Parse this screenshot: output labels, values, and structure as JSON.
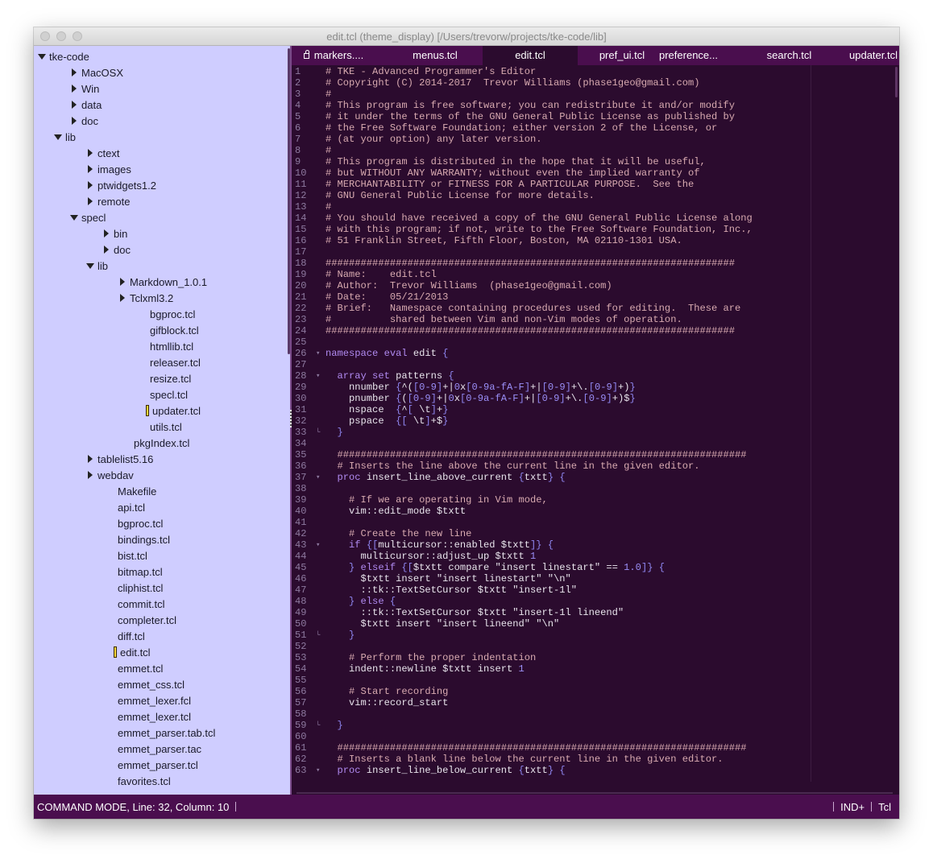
{
  "window": {
    "title": "edit.tcl (theme_display) [/Users/trevorw/projects/tke-code/lib]"
  },
  "colors": {
    "comment": "#d8aab0",
    "keyword": "#b08af0",
    "bracket": "#8f86f0",
    "number": "#9b8ff8",
    "text": "#e8e4ec",
    "sidebar_bg": "#cfcdff",
    "tab_bg": "#4a0e4e",
    "editor_bg": "#2b0b2e"
  },
  "sidebar": {
    "items": [
      {
        "label": "tke-code",
        "type": "folder-open"
      },
      {
        "label": "MacOSX",
        "type": "folder"
      },
      {
        "label": "Win",
        "type": "folder"
      },
      {
        "label": "data",
        "type": "folder"
      },
      {
        "label": "doc",
        "type": "folder"
      },
      {
        "label": "lib",
        "type": "folder-open"
      },
      {
        "label": "ctext",
        "type": "folder"
      },
      {
        "label": "images",
        "type": "folder"
      },
      {
        "label": "ptwidgets1.2",
        "type": "folder"
      },
      {
        "label": "remote",
        "type": "folder"
      },
      {
        "label": "specl",
        "type": "folder-open"
      },
      {
        "label": "bin",
        "type": "folder"
      },
      {
        "label": "doc",
        "type": "folder"
      },
      {
        "label": "lib",
        "type": "folder-open"
      },
      {
        "label": "Markdown_1.0.1",
        "type": "folder"
      },
      {
        "label": "Tclxml3.2",
        "type": "folder"
      },
      {
        "label": "bgproc.tcl",
        "type": "file"
      },
      {
        "label": "gifblock.tcl",
        "type": "file"
      },
      {
        "label": "htmllib.tcl",
        "type": "file"
      },
      {
        "label": "releaser.tcl",
        "type": "file"
      },
      {
        "label": "resize.tcl",
        "type": "file"
      },
      {
        "label": "specl.tcl",
        "type": "file"
      },
      {
        "label": "updater.tcl",
        "type": "file-open"
      },
      {
        "label": "utils.tcl",
        "type": "file"
      },
      {
        "label": "pkgIndex.tcl",
        "type": "file"
      },
      {
        "label": "tablelist5.16",
        "type": "folder"
      },
      {
        "label": "webdav",
        "type": "folder"
      },
      {
        "label": "Makefile",
        "type": "file"
      },
      {
        "label": "api.tcl",
        "type": "file"
      },
      {
        "label": "bgproc.tcl",
        "type": "file"
      },
      {
        "label": "bindings.tcl",
        "type": "file"
      },
      {
        "label": "bist.tcl",
        "type": "file"
      },
      {
        "label": "bitmap.tcl",
        "type": "file"
      },
      {
        "label": "cliphist.tcl",
        "type": "file"
      },
      {
        "label": "commit.tcl",
        "type": "file"
      },
      {
        "label": "completer.tcl",
        "type": "file"
      },
      {
        "label": "diff.tcl",
        "type": "file"
      },
      {
        "label": "edit.tcl",
        "type": "file-open"
      },
      {
        "label": "emmet.tcl",
        "type": "file"
      },
      {
        "label": "emmet_css.tcl",
        "type": "file"
      },
      {
        "label": "emmet_lexer.fcl",
        "type": "file"
      },
      {
        "label": "emmet_lexer.tcl",
        "type": "file"
      },
      {
        "label": "emmet_parser.tab.tcl",
        "type": "file"
      },
      {
        "label": "emmet_parser.tac",
        "type": "file"
      },
      {
        "label": "emmet_parser.tcl",
        "type": "file"
      },
      {
        "label": "favorites.tcl",
        "type": "file"
      }
    ]
  },
  "tabs": [
    {
      "label": "markers....",
      "locked": true
    },
    {
      "label": "menus.tcl"
    },
    {
      "label": "edit.tcl",
      "active": true
    },
    {
      "label": "pref_ui.tcl"
    },
    {
      "label": "preference..."
    },
    {
      "label": "search.tcl"
    },
    {
      "label": "updater.tcl"
    }
  ],
  "code": [
    {
      "n": "1",
      "segs": [
        [
          "c",
          "# TKE - Advanced Programmer's Editor"
        ]
      ]
    },
    {
      "n": "2",
      "segs": [
        [
          "c",
          "# Copyright (C) 2014-2017  Trevor Williams (phase1geo@gmail.com)"
        ]
      ]
    },
    {
      "n": "3",
      "segs": [
        [
          "c",
          "#"
        ]
      ]
    },
    {
      "n": "4",
      "segs": [
        [
          "c",
          "# This program is free software; you can redistribute it and/or modify"
        ]
      ]
    },
    {
      "n": "5",
      "segs": [
        [
          "c",
          "# it under the terms of the GNU General Public License as published by"
        ]
      ]
    },
    {
      "n": "6",
      "segs": [
        [
          "c",
          "# the Free Software Foundation; either version 2 of the License, or"
        ]
      ]
    },
    {
      "n": "7",
      "segs": [
        [
          "c",
          "# (at your option) any later version."
        ]
      ]
    },
    {
      "n": "8",
      "segs": [
        [
          "c",
          "#"
        ]
      ]
    },
    {
      "n": "9",
      "segs": [
        [
          "c",
          "# This program is distributed in the hope that it will be useful,"
        ]
      ]
    },
    {
      "n": "10",
      "segs": [
        [
          "c",
          "# but WITHOUT ANY WARRANTY; without even the implied warranty of"
        ]
      ]
    },
    {
      "n": "11",
      "segs": [
        [
          "c",
          "# MERCHANTABILITY or FITNESS FOR A PARTICULAR PURPOSE.  See the"
        ]
      ]
    },
    {
      "n": "12",
      "segs": [
        [
          "c",
          "# GNU General Public License for more details."
        ]
      ]
    },
    {
      "n": "13",
      "segs": [
        [
          "c",
          "#"
        ]
      ]
    },
    {
      "n": "14",
      "segs": [
        [
          "c",
          "# You should have received a copy of the GNU General Public License along"
        ]
      ]
    },
    {
      "n": "15",
      "segs": [
        [
          "c",
          "# with this program; if not, write to the Free Software Foundation, Inc.,"
        ]
      ]
    },
    {
      "n": "16",
      "segs": [
        [
          "c",
          "# 51 Franklin Street, Fifth Floor, Boston, MA 02110-1301 USA."
        ]
      ]
    },
    {
      "n": "17",
      "segs": []
    },
    {
      "n": "18",
      "segs": [
        [
          "c",
          "######################################################################"
        ]
      ]
    },
    {
      "n": "19",
      "segs": [
        [
          "c",
          "# Name:    edit.tcl"
        ]
      ]
    },
    {
      "n": "20",
      "segs": [
        [
          "c",
          "# Author:  Trevor Williams  (phase1geo@gmail.com)"
        ]
      ]
    },
    {
      "n": "21",
      "segs": [
        [
          "c",
          "# Date:    05/21/2013"
        ]
      ]
    },
    {
      "n": "22",
      "segs": [
        [
          "c",
          "# Brief:   Namespace containing procedures used for editing.  These are"
        ]
      ]
    },
    {
      "n": "23",
      "segs": [
        [
          "c",
          "#          shared between Vim and non-Vim modes of operation."
        ]
      ]
    },
    {
      "n": "24",
      "segs": [
        [
          "c",
          "######################################################################"
        ]
      ]
    },
    {
      "n": "25",
      "segs": []
    },
    {
      "n": "26",
      "fold": "▾",
      "segs": [
        [
          "k",
          "namespace eval "
        ],
        [
          "t",
          "edit "
        ],
        [
          "b",
          "{"
        ]
      ]
    },
    {
      "n": "27",
      "segs": []
    },
    {
      "n": "28",
      "fold": "▾",
      "segs": [
        [
          "t",
          "  "
        ],
        [
          "k",
          "array set "
        ],
        [
          "t",
          "patterns "
        ],
        [
          "b",
          "{"
        ]
      ]
    },
    {
      "n": "29",
      "segs": [
        [
          "t",
          "    nnumber "
        ],
        [
          "b",
          "{"
        ],
        [
          "t",
          "^("
        ],
        [
          "b",
          "["
        ],
        [
          "n",
          "0-9"
        ],
        [
          "b",
          "]"
        ],
        [
          "t",
          "+|"
        ],
        [
          "n",
          "0"
        ],
        [
          "t",
          "x"
        ],
        [
          "b",
          "["
        ],
        [
          "n",
          "0-9a-fA-F"
        ],
        [
          "b",
          "]"
        ],
        [
          "t",
          "+|"
        ],
        [
          "b",
          "["
        ],
        [
          "n",
          "0-9"
        ],
        [
          "b",
          "]"
        ],
        [
          "t",
          "+\\."
        ],
        [
          "b",
          "["
        ],
        [
          "n",
          "0-9"
        ],
        [
          "b",
          "]"
        ],
        [
          "t",
          "+)"
        ],
        [
          "b",
          "}"
        ]
      ]
    },
    {
      "n": "30",
      "segs": [
        [
          "t",
          "    pnumber "
        ],
        [
          "b",
          "{"
        ],
        [
          "t",
          "("
        ],
        [
          "b",
          "["
        ],
        [
          "n",
          "0-9"
        ],
        [
          "b",
          "]"
        ],
        [
          "t",
          "+|"
        ],
        [
          "n",
          "0"
        ],
        [
          "t",
          "x"
        ],
        [
          "b",
          "["
        ],
        [
          "n",
          "0-9a-fA-F"
        ],
        [
          "b",
          "]"
        ],
        [
          "t",
          "+|"
        ],
        [
          "b",
          "["
        ],
        [
          "n",
          "0-9"
        ],
        [
          "b",
          "]"
        ],
        [
          "t",
          "+\\."
        ],
        [
          "b",
          "["
        ],
        [
          "n",
          "0-9"
        ],
        [
          "b",
          "]"
        ],
        [
          "t",
          "+)$"
        ],
        [
          "b",
          "}"
        ]
      ]
    },
    {
      "n": "31",
      "segs": [
        [
          "t",
          "    nspace  "
        ],
        [
          "b",
          "{"
        ],
        [
          "t",
          "^"
        ],
        [
          "b",
          "["
        ],
        [
          "t",
          " \\t"
        ],
        [
          "b",
          "]"
        ],
        [
          "t",
          "+"
        ],
        [
          "b",
          "}"
        ]
      ]
    },
    {
      "n": "32",
      "segs": [
        [
          "t",
          "    pspace  "
        ],
        [
          "b",
          "{["
        ],
        [
          "t",
          " \\t"
        ],
        [
          "b",
          "]"
        ],
        [
          "t",
          "+$"
        ],
        [
          "b",
          "}"
        ]
      ]
    },
    {
      "n": "33",
      "fold": "└",
      "segs": [
        [
          "t",
          "  "
        ],
        [
          "b",
          "}"
        ]
      ]
    },
    {
      "n": "34",
      "segs": []
    },
    {
      "n": "35",
      "segs": [
        [
          "c",
          "  ######################################################################"
        ]
      ]
    },
    {
      "n": "36",
      "segs": [
        [
          "c",
          "  # Inserts the line above the current line in the given editor."
        ]
      ]
    },
    {
      "n": "37",
      "fold": "▾",
      "segs": [
        [
          "t",
          "  "
        ],
        [
          "k",
          "proc "
        ],
        [
          "t",
          "insert_line_above_current "
        ],
        [
          "b",
          "{"
        ],
        [
          "t",
          "txtt"
        ],
        [
          "b",
          "} {"
        ]
      ]
    },
    {
      "n": "38",
      "segs": []
    },
    {
      "n": "39",
      "segs": [
        [
          "c",
          "    # If we are operating in Vim mode,"
        ]
      ]
    },
    {
      "n": "40",
      "segs": [
        [
          "t",
          "    vim::edit_mode $txtt"
        ]
      ]
    },
    {
      "n": "41",
      "segs": []
    },
    {
      "n": "42",
      "segs": [
        [
          "c",
          "    # Create the new line"
        ]
      ]
    },
    {
      "n": "43",
      "fold": "▾",
      "segs": [
        [
          "t",
          "    "
        ],
        [
          "k",
          "if "
        ],
        [
          "b",
          "{["
        ],
        [
          "t",
          "multicursor::enabled $txtt"
        ],
        [
          "b",
          "]} {"
        ]
      ]
    },
    {
      "n": "44",
      "segs": [
        [
          "t",
          "      multicursor::adjust_up $txtt "
        ],
        [
          "n",
          "1"
        ]
      ]
    },
    {
      "n": "45",
      "segs": [
        [
          "t",
          "    "
        ],
        [
          "b",
          "} "
        ],
        [
          "k",
          "elseif "
        ],
        [
          "b",
          "{["
        ],
        [
          "t",
          "$txtt compare \"insert linestart\" == "
        ],
        [
          "n",
          "1.0"
        ],
        [
          "b",
          "]} {"
        ]
      ]
    },
    {
      "n": "46",
      "segs": [
        [
          "t",
          "      $txtt insert \"insert linestart\" \"\\n\""
        ]
      ]
    },
    {
      "n": "47",
      "segs": [
        [
          "t",
          "      ::tk::TextSetCursor $txtt \"insert-1l\""
        ]
      ]
    },
    {
      "n": "48",
      "segs": [
        [
          "t",
          "    "
        ],
        [
          "b",
          "} "
        ],
        [
          "k",
          "else "
        ],
        [
          "b",
          "{"
        ]
      ]
    },
    {
      "n": "49",
      "segs": [
        [
          "t",
          "      ::tk::TextSetCursor $txtt \"insert-1l lineend\""
        ]
      ]
    },
    {
      "n": "50",
      "segs": [
        [
          "t",
          "      $txtt insert \"insert lineend\" \"\\n\""
        ]
      ]
    },
    {
      "n": "51",
      "fold": "└",
      "segs": [
        [
          "t",
          "    "
        ],
        [
          "b",
          "}"
        ]
      ]
    },
    {
      "n": "52",
      "segs": []
    },
    {
      "n": "53",
      "segs": [
        [
          "c",
          "    # Perform the proper indentation"
        ]
      ]
    },
    {
      "n": "54",
      "segs": [
        [
          "t",
          "    indent::newline $txtt insert "
        ],
        [
          "n",
          "1"
        ]
      ]
    },
    {
      "n": "55",
      "segs": []
    },
    {
      "n": "56",
      "segs": [
        [
          "c",
          "    # Start recording"
        ]
      ]
    },
    {
      "n": "57",
      "segs": [
        [
          "t",
          "    vim::record_start"
        ]
      ]
    },
    {
      "n": "58",
      "segs": []
    },
    {
      "n": "59",
      "fold": "└",
      "segs": [
        [
          "t",
          "  "
        ],
        [
          "b",
          "}"
        ]
      ]
    },
    {
      "n": "60",
      "segs": []
    },
    {
      "n": "61",
      "segs": [
        [
          "c",
          "  ######################################################################"
        ]
      ]
    },
    {
      "n": "62",
      "segs": [
        [
          "c",
          "  # Inserts a blank line below the current line in the given editor."
        ]
      ]
    },
    {
      "n": "63",
      "fold": "▾",
      "segs": [
        [
          "t",
          "  "
        ],
        [
          "k",
          "proc "
        ],
        [
          "t",
          "insert_line_below_current "
        ],
        [
          "b",
          "{"
        ],
        [
          "t",
          "txtt"
        ],
        [
          "b",
          "} {"
        ]
      ]
    }
  ],
  "status": {
    "left": "COMMAND MODE, Line: 32, Column: 10",
    "indent": "IND+",
    "language": "Tcl"
  }
}
